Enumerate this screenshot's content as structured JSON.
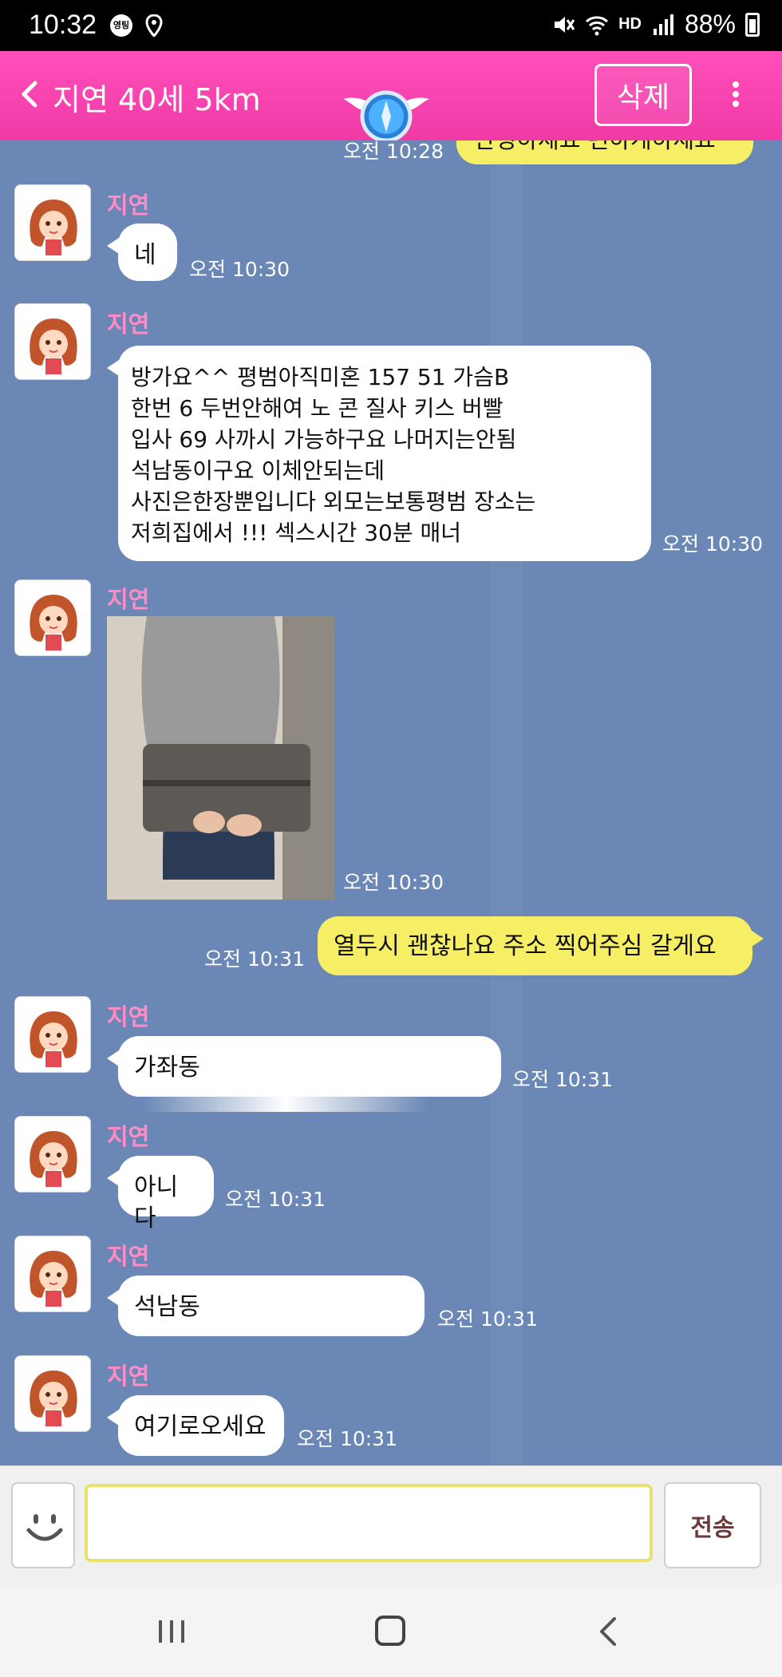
{
  "status_bar": {
    "time": "10:32",
    "badge": "영팅",
    "hd_label": "HD",
    "battery": "88%"
  },
  "header": {
    "title": "지연 40세 5km",
    "delete_label": "삭제"
  },
  "messages": [
    {
      "type": "out",
      "text": "안녕하세요 편하게하세요",
      "time": "오전 10:28"
    },
    {
      "type": "in",
      "sender": "지연",
      "text": "네",
      "time": "오전 10:30"
    },
    {
      "type": "in",
      "sender": "지연",
      "lines": [
        "방가요^^  평범아직미혼   157   51   가슴B",
        "한번 6   두번안해여   노 콘   질사   키스  버빨",
        "입사   69   사까시  가능하구요   나머지는안됨",
        "석남동이구요    이체안되는데",
        "사진은한장뿐입니다    외모는보통평범   장소는",
        "저희집에서 !!! 섹스시간 30분 매너"
      ],
      "time": "오전 10:30"
    },
    {
      "type": "in-photo",
      "sender": "지연",
      "time": "오전 10:30"
    },
    {
      "type": "out",
      "text": "열두시 괜찮나요 주소 찍어주심 갈게요",
      "time": "오전 10:31"
    },
    {
      "type": "in",
      "sender": "지연",
      "text": "가좌동",
      "time": "오전 10:31"
    },
    {
      "type": "in",
      "sender": "지연",
      "text": "아니다",
      "time": "오전 10:31"
    },
    {
      "type": "in",
      "sender": "지연",
      "text": "석남동",
      "time": "오전 10:31"
    },
    {
      "type": "in",
      "sender": "지연",
      "text": "여기로오세요",
      "time": "오전 10:31"
    }
  ],
  "input": {
    "placeholder": "",
    "send_label": "전송"
  },
  "colors": {
    "header_pink": "#f03aa6",
    "chat_bg": "#6a87b5",
    "sender_pink": "#ff8cc6",
    "out_bubble": "#f6ee64"
  }
}
